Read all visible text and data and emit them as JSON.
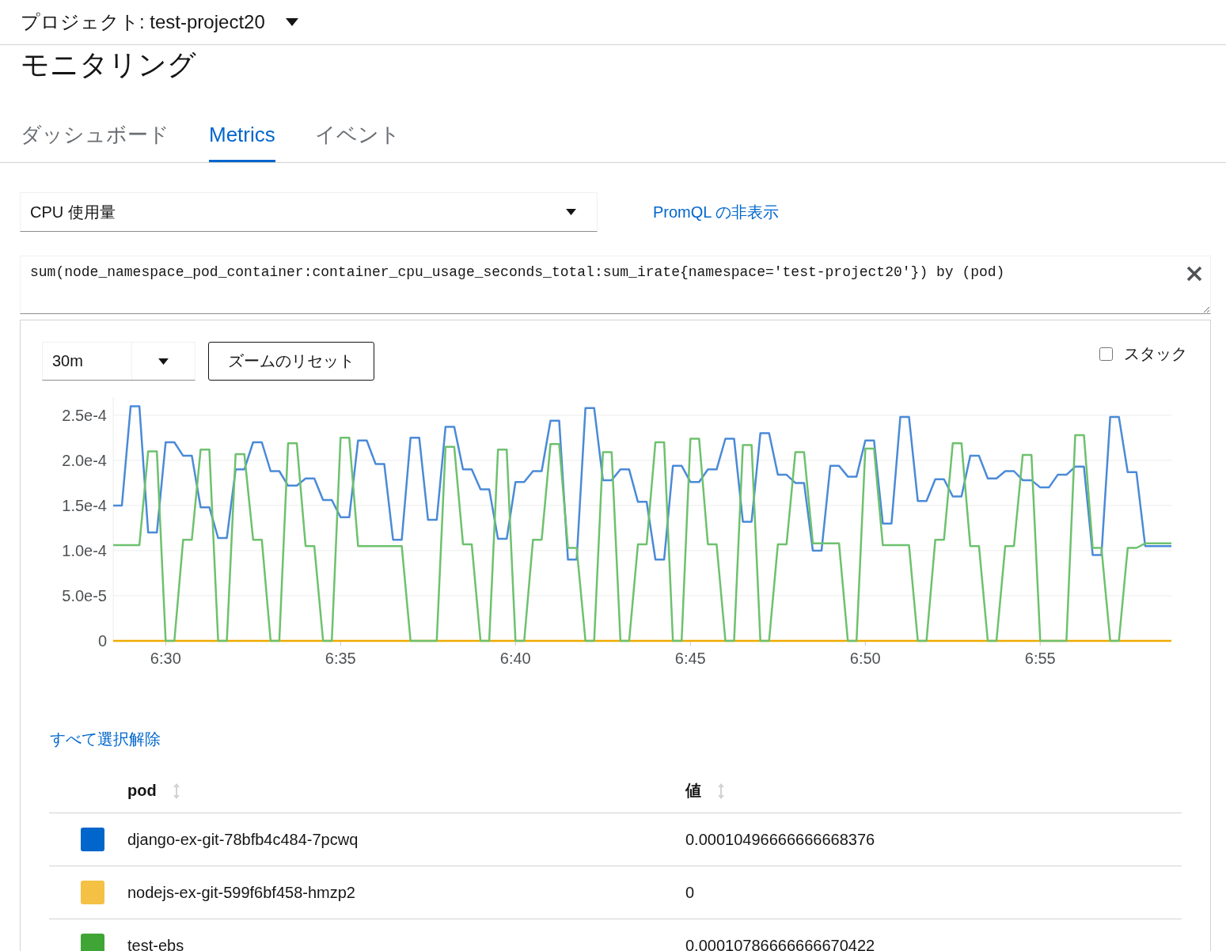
{
  "header": {
    "project_label": "プロジェクト: test-project20"
  },
  "page_title": "モニタリング",
  "tabs": [
    {
      "label": "ダッシュボード",
      "selected": false
    },
    {
      "label": "Metrics",
      "selected": true
    },
    {
      "label": "イベント",
      "selected": false
    }
  ],
  "query_select": {
    "value": "CPU 使用量"
  },
  "promql_toggle": "PromQL の非表示",
  "query": {
    "value": "sum(node_namespace_pod_container:container_cpu_usage_seconds_total:sum_irate{namespace='test-project20'}) by (pod)"
  },
  "time_range": {
    "value": "30m"
  },
  "reset_zoom_button": "ズームのリセット",
  "stack": {
    "label": "スタック",
    "checked": false
  },
  "chart_data": {
    "type": "line",
    "categories": [
      null,
      null,
      null,
      null,
      null,
      null,
      "6:30",
      null,
      null,
      null,
      null,
      null,
      null,
      null,
      null,
      null,
      null,
      null,
      null,
      null,
      null,
      null,
      null,
      null,
      null,
      null,
      "6:35",
      null,
      null,
      null,
      null,
      null,
      null,
      null,
      null,
      null,
      null,
      null,
      null,
      null,
      null,
      null,
      null,
      null,
      null,
      null,
      "6:40",
      null,
      null,
      null,
      null,
      null,
      null,
      null,
      null,
      null,
      null,
      null,
      null,
      null,
      null,
      null,
      null,
      null,
      null,
      null,
      "6:45",
      null,
      null,
      null,
      null,
      null,
      null,
      null,
      null,
      null,
      null,
      null,
      null,
      null,
      null,
      null,
      null,
      null,
      null,
      null,
      "6:50",
      null,
      null,
      null,
      null,
      null,
      null,
      null,
      null,
      null,
      null,
      null,
      null,
      null,
      null,
      null,
      null,
      null,
      null,
      null,
      "6:55",
      null,
      null,
      null,
      null,
      null,
      null,
      null,
      null,
      null,
      null,
      null,
      null,
      null,
      null,
      null
    ],
    "grid": true,
    "ylim": [
      0,
      0.00027
    ],
    "yticks": [
      {
        "value": 0,
        "label": "0"
      },
      {
        "value": 5e-05,
        "label": "5.0e-5"
      },
      {
        "value": 0.0001,
        "label": "1.0e-4"
      },
      {
        "value": 0.00015,
        "label": "1.5e-4"
      },
      {
        "value": 0.0002,
        "label": "2.0e-4"
      },
      {
        "value": 0.00025,
        "label": "2.5e-4"
      }
    ],
    "series": [
      {
        "color": "#4a8ad8",
        "values": [
          0.00015,
          0.00015,
          0.00026,
          0.00026,
          0.00012,
          0.00012,
          0.00022,
          0.00022,
          0.000205,
          0.000205,
          0.000148,
          0.000148,
          0.000114,
          0.000114,
          0.00019,
          0.00019,
          0.00022,
          0.00022,
          0.000188,
          0.000188,
          0.000172,
          0.000172,
          0.00018,
          0.00018,
          0.000156,
          0.000156,
          0.000137,
          0.000137,
          0.000222,
          0.000222,
          0.000196,
          0.000196,
          0.000112,
          0.000112,
          0.000225,
          0.000225,
          0.000134,
          0.000134,
          0.000237,
          0.000237,
          0.00019,
          0.00019,
          0.000168,
          0.000168,
          0.000113,
          0.000113,
          0.000176,
          0.000176,
          0.000188,
          0.000188,
          0.000244,
          0.000244,
          9e-05,
          9e-05,
          0.000258,
          0.000258,
          0.000178,
          0.000178,
          0.00019,
          0.00019,
          0.000154,
          0.000154,
          9e-05,
          9e-05,
          0.000194,
          0.000194,
          0.000176,
          0.000176,
          0.00019,
          0.00019,
          0.000224,
          0.000224,
          0.000132,
          0.000132,
          0.00023,
          0.00023,
          0.000184,
          0.000184,
          0.000175,
          0.000175,
          0.0001,
          0.0001,
          0.000194,
          0.000194,
          0.000182,
          0.000182,
          0.000222,
          0.000222,
          0.00013,
          0.00013,
          0.000248,
          0.000248,
          0.000155,
          0.000155,
          0.000179,
          0.000179,
          0.00016,
          0.00016,
          0.000205,
          0.000205,
          0.00018,
          0.00018,
          0.000188,
          0.000188,
          0.000178,
          0.000178,
          0.00017,
          0.00017,
          0.000184,
          0.000184,
          0.000193,
          0.000193,
          9.5e-05,
          9.5e-05,
          0.000248,
          0.000248,
          0.000187,
          0.000187,
          0.000105,
          0.000105,
          0.000105,
          0.000105
        ]
      },
      {
        "color": "#f0ab00",
        "values": [
          0,
          0,
          0,
          0,
          0,
          0,
          0,
          0,
          0,
          0,
          0,
          0,
          0,
          0,
          0,
          0,
          0,
          0,
          0,
          0,
          0,
          0,
          0,
          0,
          0,
          0,
          0,
          0,
          0,
          0,
          0,
          0,
          0,
          0,
          0,
          0,
          0,
          0,
          0,
          0,
          0,
          0,
          0,
          0,
          0,
          0,
          0,
          0,
          0,
          0,
          0,
          0,
          0,
          0,
          0,
          0,
          0,
          0,
          0,
          0,
          0,
          0,
          0,
          0,
          0,
          0,
          0,
          0,
          0,
          0,
          0,
          0,
          0,
          0,
          0,
          0,
          0,
          0,
          0,
          0,
          0,
          0,
          0,
          0,
          0,
          0,
          0,
          0,
          0,
          0,
          0,
          0,
          0,
          0,
          0,
          0,
          0,
          0,
          0,
          0,
          0,
          0,
          0,
          0,
          0,
          0,
          0,
          0,
          0,
          0,
          0,
          0,
          0,
          0,
          0,
          0,
          0,
          0,
          0,
          0,
          0,
          0
        ]
      },
      {
        "color": "#6ec16e",
        "values": [
          0.000106,
          0.000106,
          0.000106,
          0.000106,
          0.00021,
          0.00021,
          0,
          0,
          0.000112,
          0.000112,
          0.000212,
          0.000212,
          0,
          0,
          0.000207,
          0.000207,
          0.000112,
          0.000112,
          0,
          0,
          0.000219,
          0.000219,
          0.000105,
          0.000105,
          0,
          0,
          0.000225,
          0.000225,
          0.000105,
          0.000105,
          0.000105,
          0.000105,
          0.000105,
          0.000105,
          0,
          0,
          0,
          0,
          0.000215,
          0.000215,
          0.000107,
          0.000107,
          0,
          0,
          0.000212,
          0.000212,
          0,
          0,
          0.000112,
          0.000112,
          0.000218,
          0.000218,
          0.000103,
          0.000103,
          0,
          0,
          0.000209,
          0.000209,
          0,
          0,
          0.000107,
          0.000107,
          0.00022,
          0.00022,
          0,
          0,
          0.000224,
          0.000224,
          0.000107,
          0.000107,
          0,
          0,
          0.000217,
          0.000217,
          0,
          0,
          0.000107,
          0.000107,
          0.000209,
          0.000209,
          0.000108,
          0.000108,
          0.000108,
          0.000108,
          0,
          0,
          0.000213,
          0.000213,
          0.000106,
          0.000106,
          0.000106,
          0.000106,
          0,
          0,
          0.000112,
          0.000112,
          0.000219,
          0.000219,
          0.000105,
          0.000105,
          0,
          0,
          0.000105,
          0.000105,
          0.000206,
          0.000206,
          0,
          0,
          0,
          0,
          0.000228,
          0.000228,
          0.000103,
          0.000103,
          0,
          0,
          0.000103,
          0.000103,
          0.000108,
          0.000108,
          0.000108,
          0.000108
        ]
      }
    ]
  },
  "unselect_all_link": "すべて選択解除",
  "table": {
    "columns": [
      "pod",
      "値"
    ],
    "rows": [
      {
        "color": "#0066cc",
        "pod": "django-ex-git-78bfb4c484-7pcwq",
        "value": "0.00010496666666668376"
      },
      {
        "color": "#f4c145",
        "pod": "nodejs-ex-git-599f6bf458-hmzp2",
        "value": "0"
      },
      {
        "color": "#3fa535",
        "pod": "test-ebs",
        "value": "0.00010786666666670422"
      }
    ]
  }
}
